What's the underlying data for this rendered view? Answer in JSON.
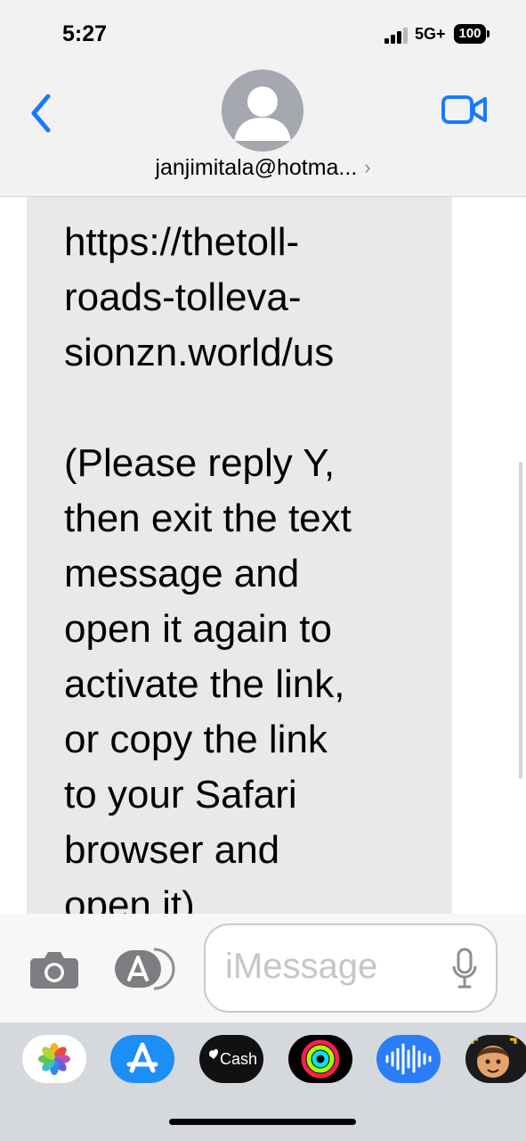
{
  "status_bar": {
    "time": "5:27",
    "network": "5G+",
    "battery": "100"
  },
  "header": {
    "contact": "janjimitala@hotma...",
    "chevron": "›"
  },
  "message": {
    "text": "https://thetoll-\nroads-tolleva-\nsionzn.world/us\n\n(Please reply Y,\nthen exit the text\nmessage and\nopen it again to\nactivate the link,\nor copy the link\nto your Safari\nbrowser and\nopen it)"
  },
  "composer": {
    "placeholder": "iMessage"
  },
  "dock": {
    "apps": [
      {
        "name": "photos-app-icon"
      },
      {
        "name": "app-store-app-icon"
      },
      {
        "name": "cash-app-icon",
        "label": "Cash"
      },
      {
        "name": "fitness-app-icon"
      },
      {
        "name": "audio-message-app-icon"
      },
      {
        "name": "memoji-app-icon"
      }
    ]
  },
  "colors": {
    "accent": "#1a7aff",
    "bubble": "#e9e9eb",
    "bar": "#f2f2f2"
  }
}
